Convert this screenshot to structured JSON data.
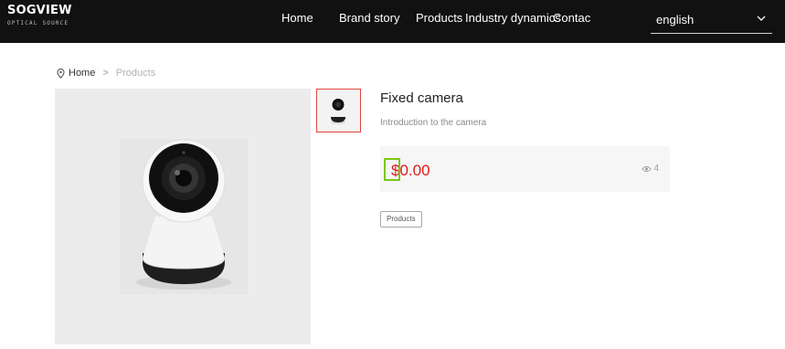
{
  "brand": {
    "name": "SOGVIEW",
    "tagline": "OPTICAL SOURCE"
  },
  "nav": {
    "items": [
      "Home",
      "Brand story",
      "Products",
      "Industry dynamics",
      "Contac"
    ]
  },
  "language": {
    "selected": "english"
  },
  "breadcrumb": {
    "home": "Home",
    "separator": ">",
    "current": "Products"
  },
  "product": {
    "title": "Fixed camera",
    "intro": "Introduction to the camera",
    "price": "$0.00",
    "views": "4",
    "tag": "Products"
  },
  "colors": {
    "header_bg": "#111111",
    "price": "#e41818",
    "thumb_border": "#e0463a",
    "price_highlight": "#7bc61e"
  },
  "icons": {
    "location": "map-pin-icon",
    "chevron": "chevron-down-icon",
    "views": "eye-icon"
  }
}
